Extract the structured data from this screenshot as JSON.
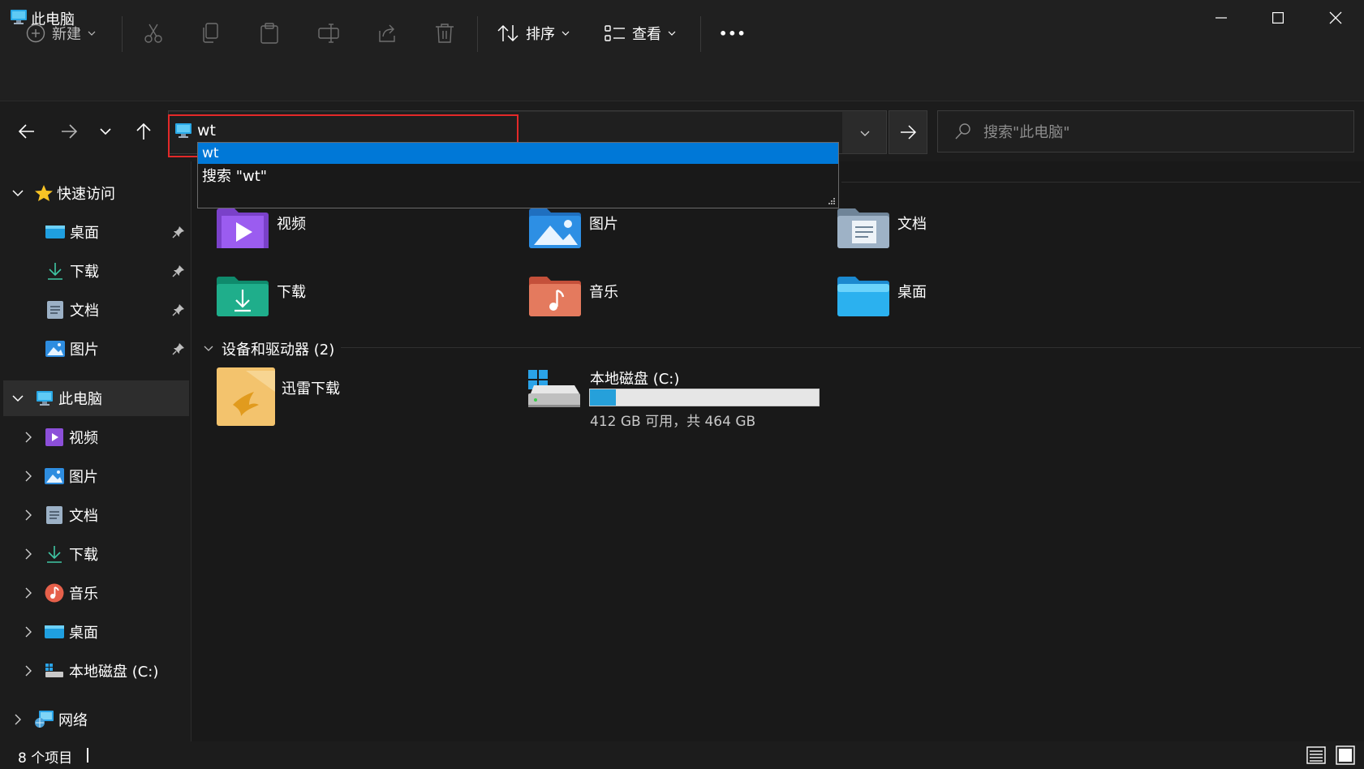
{
  "window": {
    "title": "此电脑"
  },
  "toolbar": {
    "new_label": "新建",
    "sort_label": "排序",
    "view_label": "查看",
    "more_label": "•••"
  },
  "address": {
    "value": "wt",
    "suggestions": [
      "wt",
      "搜索 \"wt\""
    ]
  },
  "search": {
    "placeholder": "搜索\"此电脑\""
  },
  "sidebar": {
    "quick_access": "快速访问",
    "quick_items": [
      "桌面",
      "下载",
      "文档",
      "图片"
    ],
    "this_pc": "此电脑",
    "pc_items": [
      "视频",
      "图片",
      "文档",
      "下载",
      "音乐",
      "桌面",
      "本地磁盘 (C:)"
    ],
    "network": "网络"
  },
  "main": {
    "folders": [
      "视频",
      "图片",
      "文档",
      "下载",
      "音乐",
      "桌面"
    ],
    "devices_heading": "设备和驱动器 (2)",
    "devices": [
      {
        "name": "迅雷下载"
      },
      {
        "name": "本地磁盘 (C:)",
        "space": "412 GB 可用，共 464 GB",
        "used_fraction": 0.112
      }
    ]
  },
  "status": {
    "count": "8 个项目"
  },
  "colors": {
    "accent": "#0078d7",
    "highlight_box": "#e32929",
    "drive_fill": "#26a0da"
  }
}
